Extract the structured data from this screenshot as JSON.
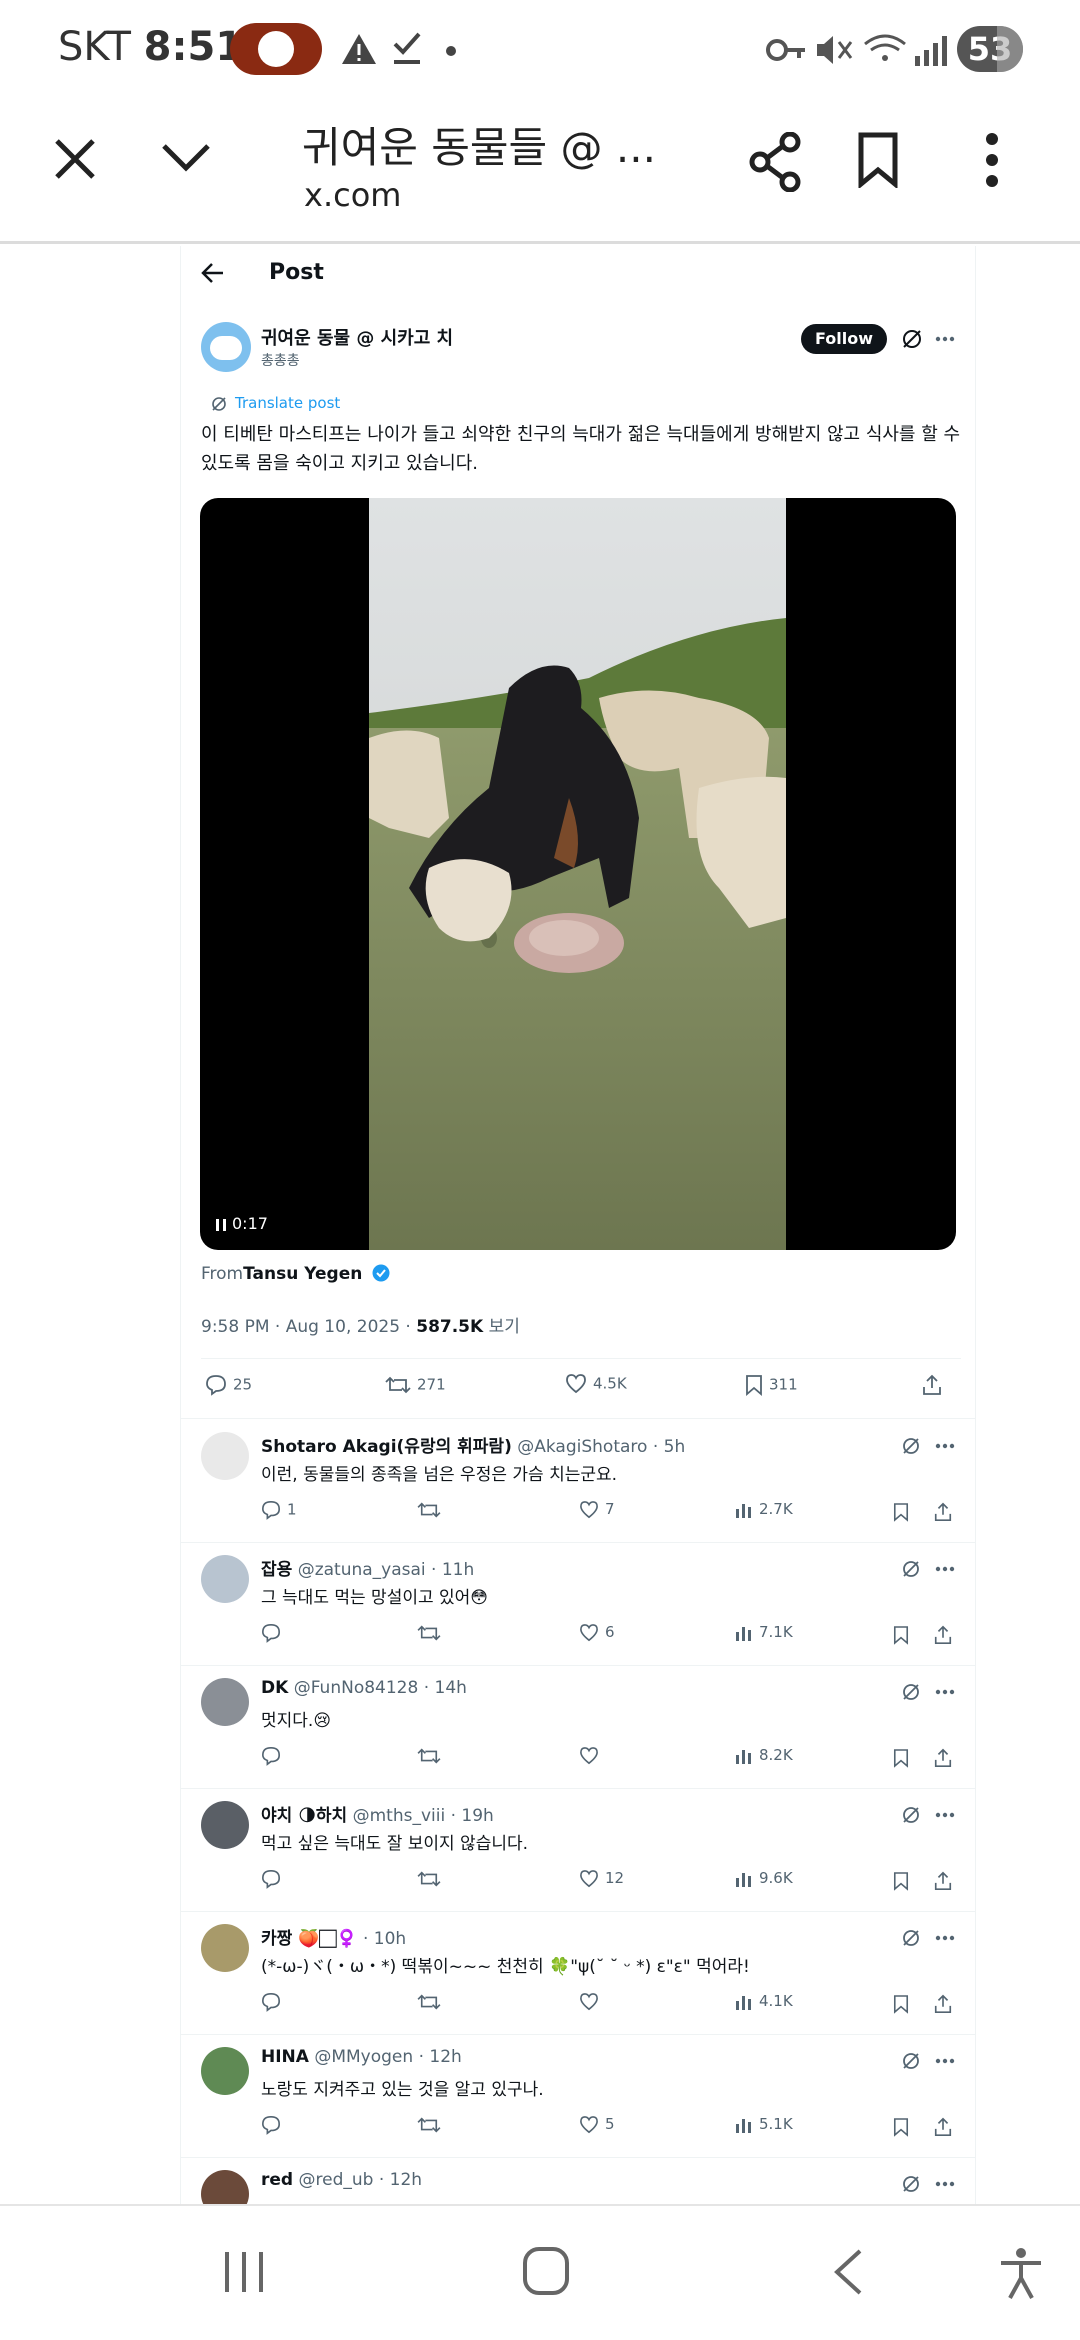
{
  "status_bar": {
    "carrier": "SKT",
    "time": "8:51",
    "battery": "53"
  },
  "browser": {
    "tab_title": "귀여운 동물들 @ ...",
    "host": "x.com"
  },
  "post_header": {
    "label": "Post"
  },
  "tweet": {
    "author_name": "귀여운 동물 @ 시카고 치",
    "author_handle": "총총총",
    "follow_label": "Follow",
    "translate_label": "Translate post",
    "text": "이 티베탄 마스티프는 나이가 들고 쇠약한 친구의 늑대가 젊은 늑대들에게 방해받지 않고 식사를 할 수 있도록 몸을 숙이고 지키고 있습니다.",
    "video_time": "0:17",
    "from_label": "From",
    "from_user": "Tansu Yegen",
    "timestamp": "9:58 PM · Aug 10, 2025 · ",
    "views": "587.5K",
    "views_label": " 보기",
    "replies": "25",
    "retweets": "271",
    "likes": "4.5K",
    "bookmarks": "311"
  },
  "replies": [
    {
      "name": "Shotaro Akagi(유랑의 휘파람)",
      "handle": "@AkagiShotaro · 5h",
      "text": "이런, 동물들의 종족을 넘은 우정은 가슴 치는군요.",
      "reply": "1",
      "rt": "",
      "like": "7",
      "views": "2.7K",
      "avatar_color": "#e9e9e9"
    },
    {
      "name": "잡용",
      "handle": "@zatuna_yasai · 11h",
      "text": "그 늑대도 먹는 망설이고 있어😳",
      "reply": "",
      "rt": "",
      "like": "6",
      "views": "7.1K",
      "avatar_color": "#b8c4d0"
    },
    {
      "name": "DK",
      "handle": "@FunNo84128 · 14h",
      "text": "멋지다.😢",
      "reply": "",
      "rt": "",
      "like": "",
      "views": "8.2K",
      "avatar_color": "#8a8f96"
    },
    {
      "name": "야치 🌗하치",
      "handle": "@mths_viii · 19h",
      "text": "먹고 싶은 늑대도 잘 보이지 않습니다.",
      "reply": "",
      "rt": "",
      "like": "12",
      "views": "9.6K",
      "avatar_color": "#5a5f66"
    },
    {
      "name": "카짱 🍑🏻♀️",
      "handle": "· 10h",
      "text": "(*-ω-)ヾ(・ω・*) 떡볶이~~~ 천천히 🍀\"ψ(˘ ˘ ᵕ *) ε\"ε\" 먹어라!",
      "reply": "",
      "rt": "",
      "like": "",
      "views": "4.1K",
      "avatar_color": "#a89a6a"
    },
    {
      "name": "HINA",
      "handle": "@MMyogen · 12h",
      "text": "노랑도 지켜주고 있는 것을 알고 있구나.",
      "reply": "",
      "rt": "",
      "like": "5",
      "views": "5.1K",
      "avatar_color": "#5f8a54"
    },
    {
      "name": "red",
      "handle": "@red_ub · 12h",
      "text": "",
      "reply": "",
      "rt": "",
      "like": "",
      "views": "",
      "avatar_color": "#6b4a3a"
    }
  ]
}
